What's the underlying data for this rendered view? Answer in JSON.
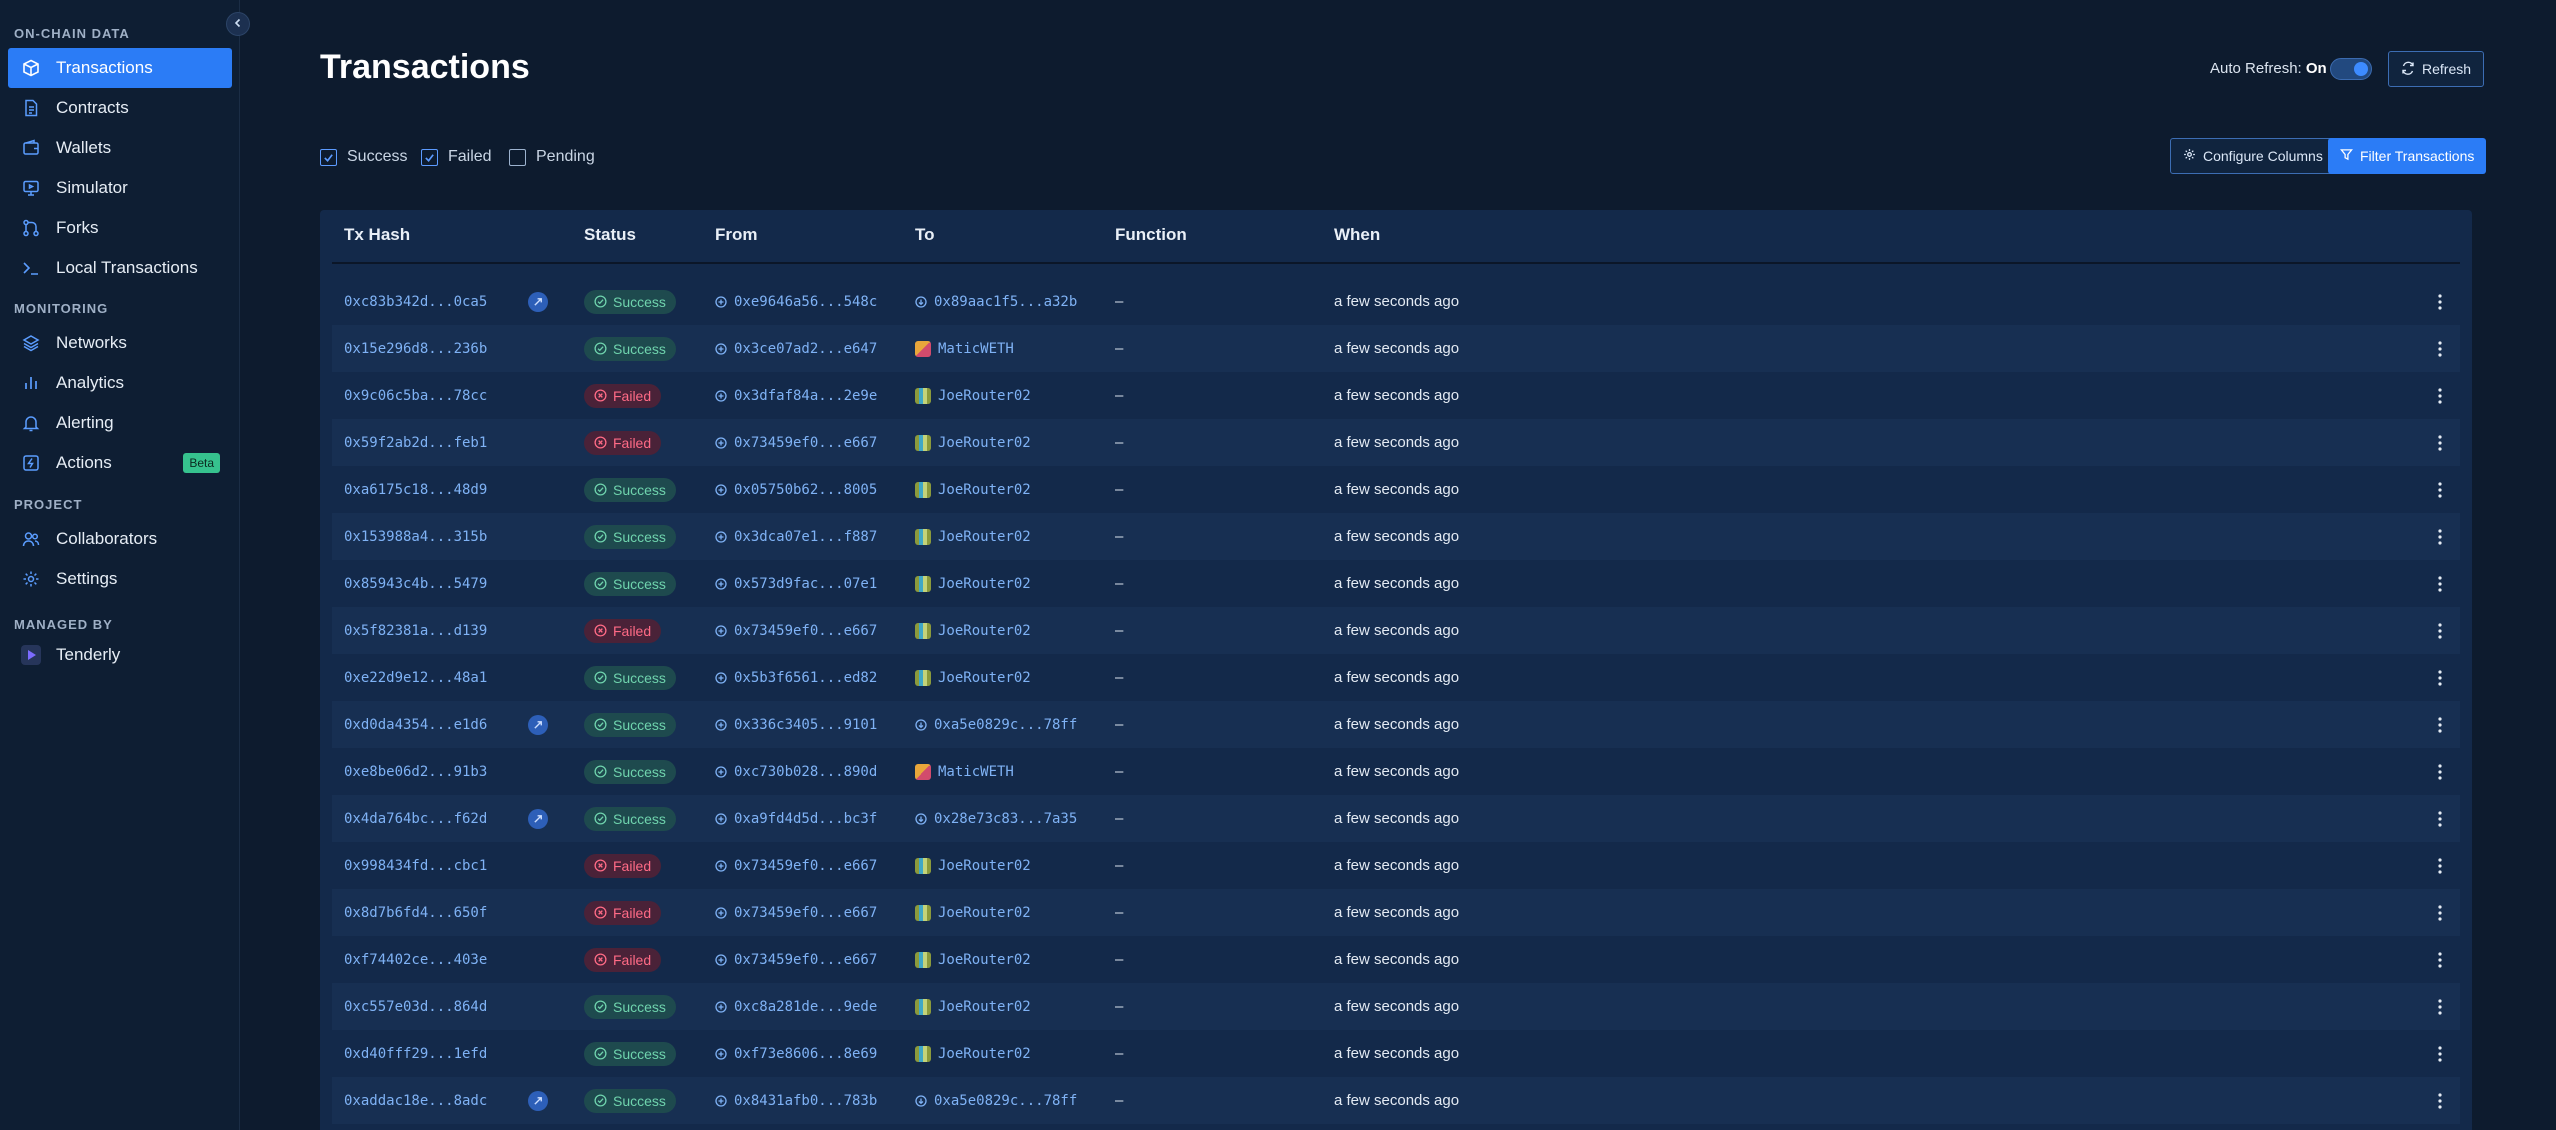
{
  "sidebar": {
    "sections": [
      {
        "label": "ON-CHAIN DATA"
      },
      {
        "label": "MONITORING"
      },
      {
        "label": "PROJECT"
      },
      {
        "label": "MANAGED BY"
      }
    ],
    "items": [
      {
        "label": "Transactions",
        "icon": "cube-icon"
      },
      {
        "label": "Contracts",
        "icon": "document-icon"
      },
      {
        "label": "Wallets",
        "icon": "wallet-icon"
      },
      {
        "label": "Simulator",
        "icon": "monitor-icon"
      },
      {
        "label": "Forks",
        "icon": "fork-icon"
      },
      {
        "label": "Local Transactions",
        "icon": "terminal-icon"
      },
      {
        "label": "Networks",
        "icon": "layers-icon"
      },
      {
        "label": "Analytics",
        "icon": "bar-chart-icon"
      },
      {
        "label": "Alerting",
        "icon": "bell-icon"
      },
      {
        "label": "Actions",
        "icon": "lightning-icon",
        "badge": "Beta"
      },
      {
        "label": "Collaborators",
        "icon": "users-icon"
      },
      {
        "label": "Settings",
        "icon": "gear-icon"
      },
      {
        "label": "Tenderly",
        "icon": "play-icon"
      }
    ]
  },
  "header": {
    "title": "Transactions",
    "auto_refresh_label": "Auto Refresh:",
    "auto_refresh_state": "On",
    "refresh_label": "Refresh",
    "configure_columns_label": "Configure Columns",
    "filter_label": "Filter Transactions"
  },
  "filters": [
    {
      "label": "Success",
      "checked": true
    },
    {
      "label": "Failed",
      "checked": true
    },
    {
      "label": "Pending",
      "checked": false
    }
  ],
  "table": {
    "columns": [
      "Tx Hash",
      "Status",
      "From",
      "To",
      "Function",
      "When"
    ],
    "rows": [
      {
        "hash": "0xc83b342d...0ca5",
        "sim": true,
        "status": "Success",
        "from": "0xe9646a56...548c",
        "to": "0x89aac1f5...a32b",
        "to_kind": "address",
        "function": "–",
        "when": "a few seconds ago"
      },
      {
        "hash": "0x15e296d8...236b",
        "sim": false,
        "status": "Success",
        "from": "0x3ce07ad2...e647",
        "to": "MaticWETH",
        "to_kind": "weth",
        "function": "–",
        "when": "a few seconds ago"
      },
      {
        "hash": "0x9c06c5ba...78cc",
        "sim": false,
        "status": "Failed",
        "from": "0x3dfaf84a...2e9e",
        "to": "JoeRouter02",
        "to_kind": "joe",
        "function": "–",
        "when": "a few seconds ago"
      },
      {
        "hash": "0x59f2ab2d...feb1",
        "sim": false,
        "status": "Failed",
        "from": "0x73459ef0...e667",
        "to": "JoeRouter02",
        "to_kind": "joe",
        "function": "–",
        "when": "a few seconds ago"
      },
      {
        "hash": "0xa6175c18...48d9",
        "sim": false,
        "status": "Success",
        "from": "0x05750b62...8005",
        "to": "JoeRouter02",
        "to_kind": "joe",
        "function": "–",
        "when": "a few seconds ago"
      },
      {
        "hash": "0x153988a4...315b",
        "sim": false,
        "status": "Success",
        "from": "0x3dca07e1...f887",
        "to": "JoeRouter02",
        "to_kind": "joe",
        "function": "–",
        "when": "a few seconds ago"
      },
      {
        "hash": "0x85943c4b...5479",
        "sim": false,
        "status": "Success",
        "from": "0x573d9fac...07e1",
        "to": "JoeRouter02",
        "to_kind": "joe",
        "function": "–",
        "when": "a few seconds ago"
      },
      {
        "hash": "0x5f82381a...d139",
        "sim": false,
        "status": "Failed",
        "from": "0x73459ef0...e667",
        "to": "JoeRouter02",
        "to_kind": "joe",
        "function": "–",
        "when": "a few seconds ago"
      },
      {
        "hash": "0xe22d9e12...48a1",
        "sim": false,
        "status": "Success",
        "from": "0x5b3f6561...ed82",
        "to": "JoeRouter02",
        "to_kind": "joe",
        "function": "–",
        "when": "a few seconds ago"
      },
      {
        "hash": "0xd0da4354...e1d6",
        "sim": true,
        "status": "Success",
        "from": "0x336c3405...9101",
        "to": "0xa5e0829c...78ff",
        "to_kind": "address",
        "function": "–",
        "when": "a few seconds ago"
      },
      {
        "hash": "0xe8be06d2...91b3",
        "sim": false,
        "status": "Success",
        "from": "0xc730b028...890d",
        "to": "MaticWETH",
        "to_kind": "weth",
        "function": "–",
        "when": "a few seconds ago"
      },
      {
        "hash": "0x4da764bc...f62d",
        "sim": true,
        "status": "Success",
        "from": "0xa9fd4d5d...bc3f",
        "to": "0x28e73c83...7a35",
        "to_kind": "address",
        "function": "–",
        "when": "a few seconds ago"
      },
      {
        "hash": "0x998434fd...cbc1",
        "sim": false,
        "status": "Failed",
        "from": "0x73459ef0...e667",
        "to": "JoeRouter02",
        "to_kind": "joe",
        "function": "–",
        "when": "a few seconds ago"
      },
      {
        "hash": "0x8d7b6fd4...650f",
        "sim": false,
        "status": "Failed",
        "from": "0x73459ef0...e667",
        "to": "JoeRouter02",
        "to_kind": "joe",
        "function": "–",
        "when": "a few seconds ago"
      },
      {
        "hash": "0xf74402ce...403e",
        "sim": false,
        "status": "Failed",
        "from": "0x73459ef0...e667",
        "to": "JoeRouter02",
        "to_kind": "joe",
        "function": "–",
        "when": "a few seconds ago"
      },
      {
        "hash": "0xc557e03d...864d",
        "sim": false,
        "status": "Success",
        "from": "0xc8a281de...9ede",
        "to": "JoeRouter02",
        "to_kind": "joe",
        "function": "–",
        "when": "a few seconds ago"
      },
      {
        "hash": "0xd40fff29...1efd",
        "sim": false,
        "status": "Success",
        "from": "0xf73e8606...8e69",
        "to": "JoeRouter02",
        "to_kind": "joe",
        "function": "–",
        "when": "a few seconds ago"
      },
      {
        "hash": "0xaddac18e...8adc",
        "sim": true,
        "status": "Success",
        "from": "0x8431afb0...783b",
        "to": "0xa5e0829c...78ff",
        "to_kind": "address",
        "function": "–",
        "when": "a few seconds ago"
      }
    ]
  },
  "colors": {
    "accent": "#2b7cf6",
    "success": "#6fd3ad",
    "failed": "#ff6b86",
    "beta": "#36c28e"
  }
}
